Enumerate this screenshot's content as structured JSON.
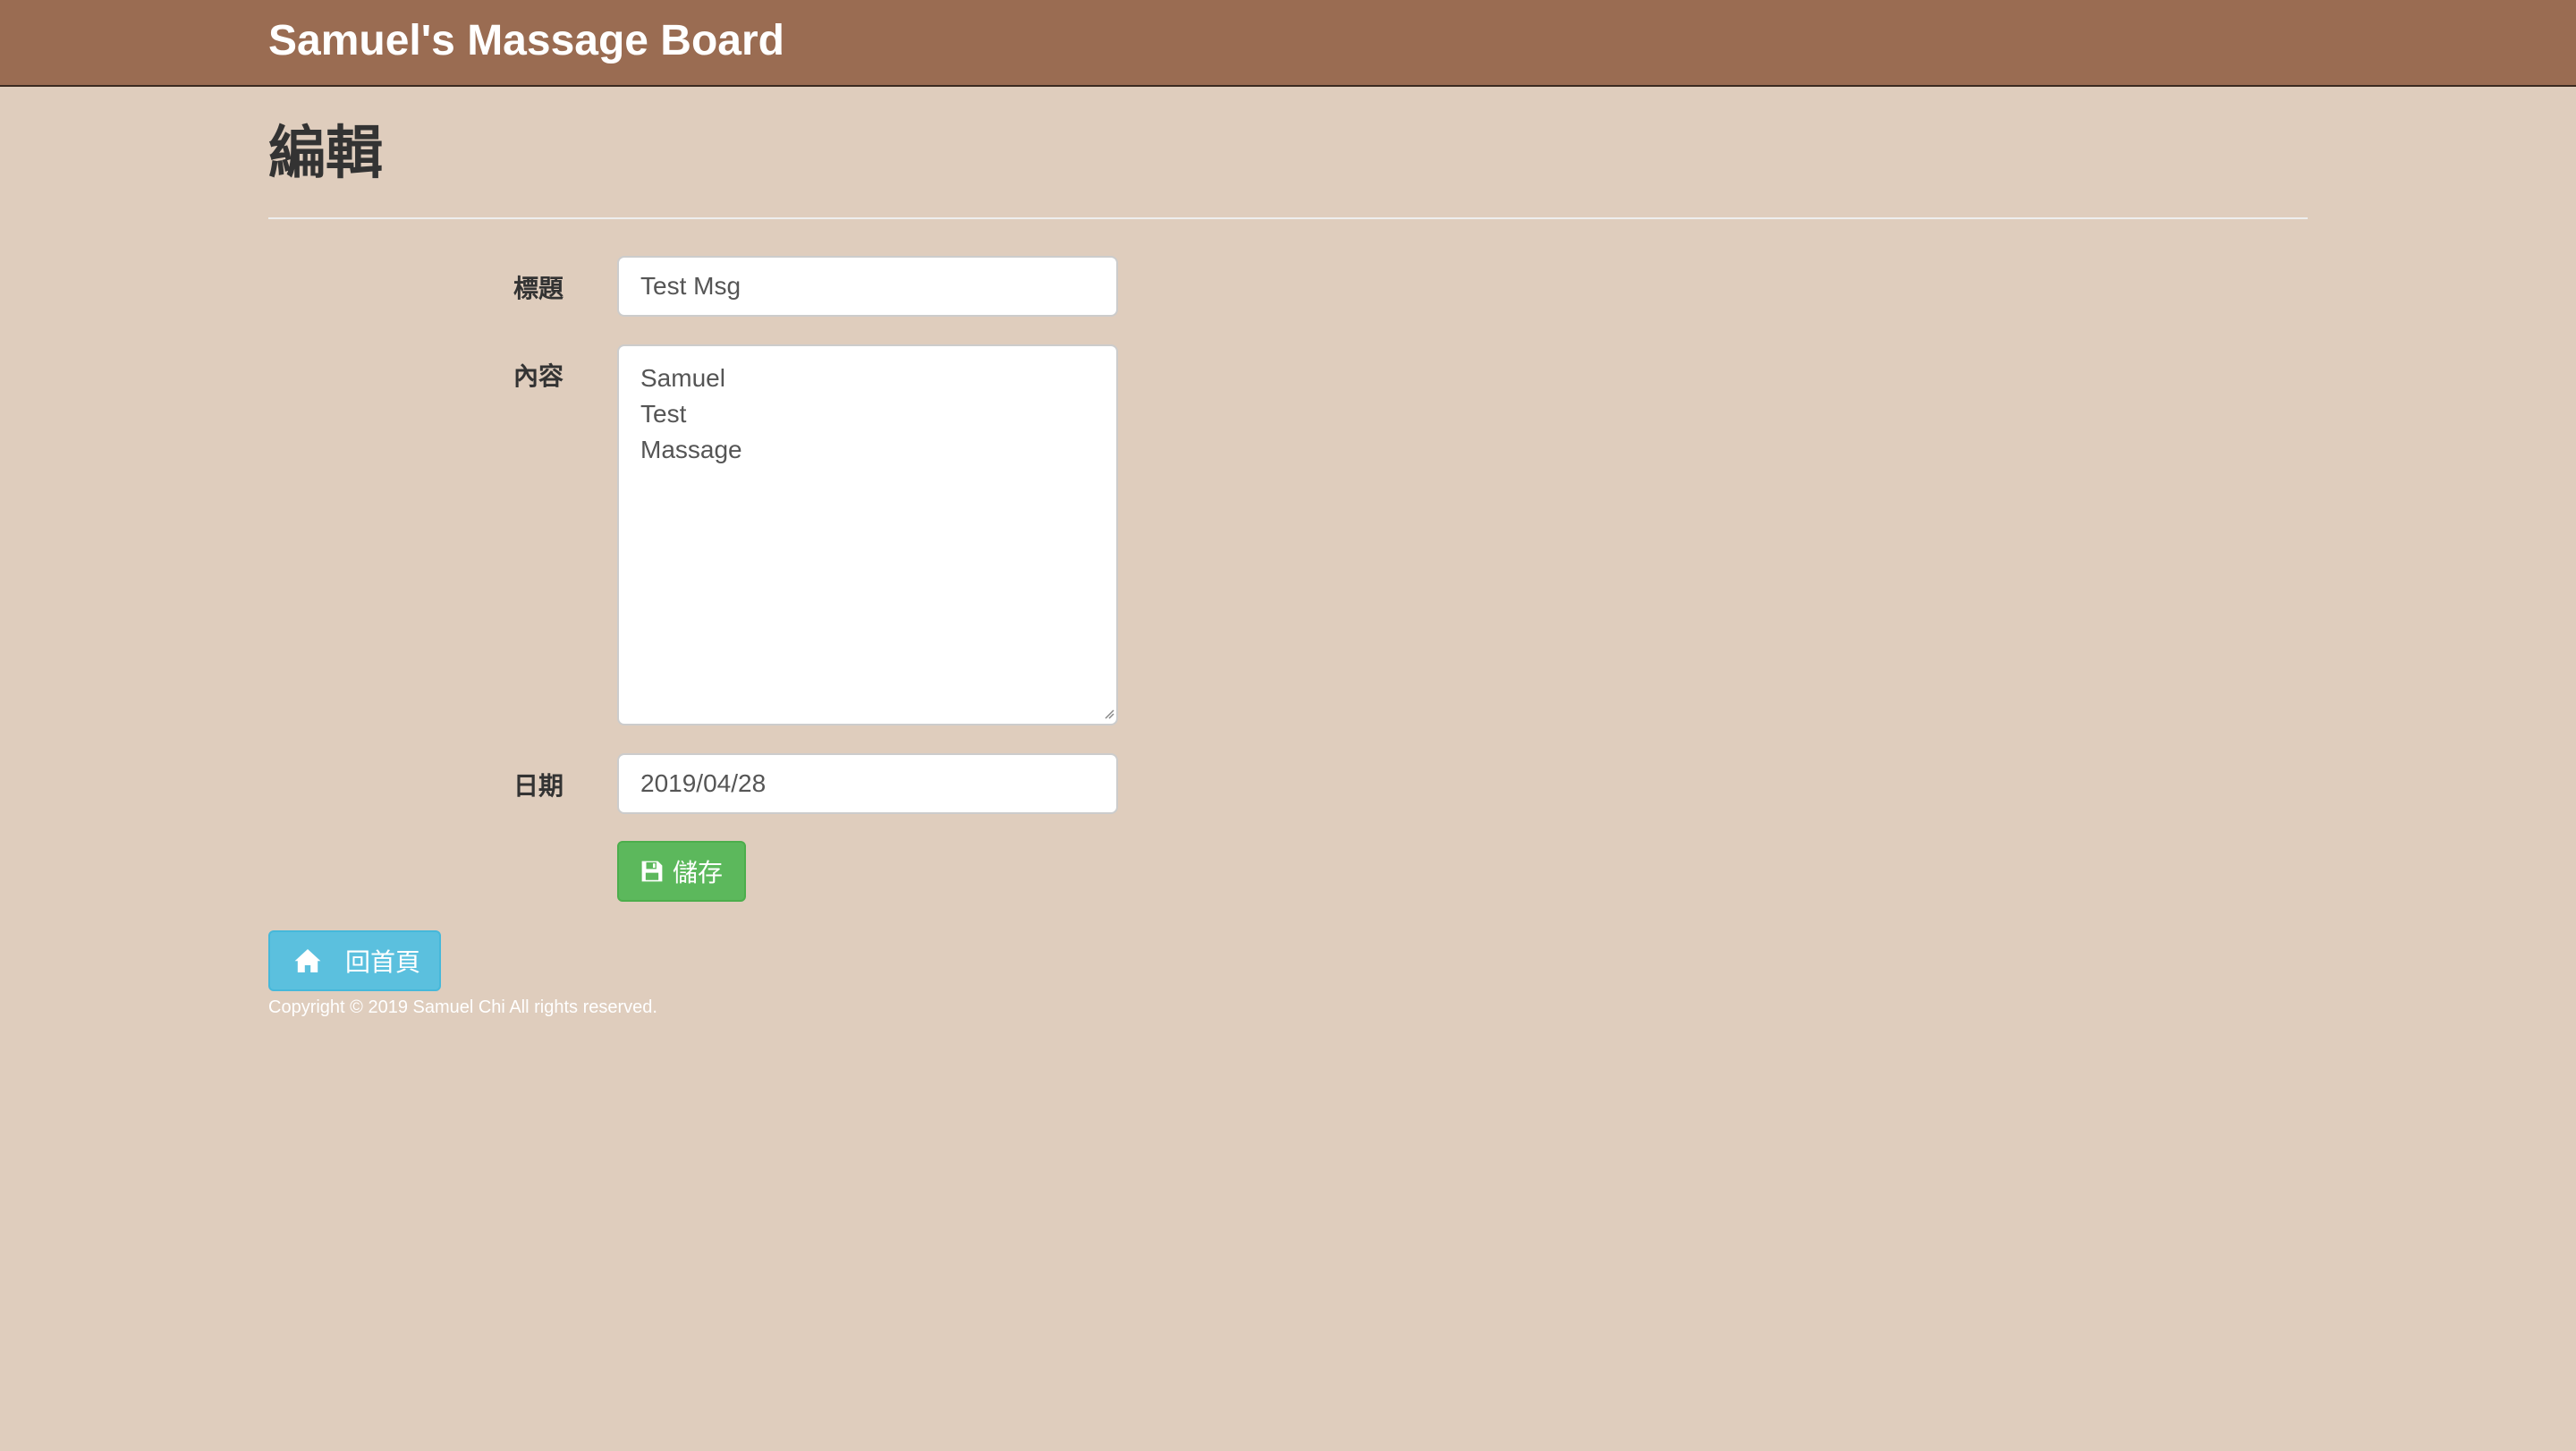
{
  "navbar": {
    "brand": "Samuel's Massage Board"
  },
  "page": {
    "title": "編輯"
  },
  "form": {
    "title_label": "標題",
    "title_value": "Test Msg",
    "content_label": "內容",
    "content_value": "Samuel\nTest\nMassage",
    "date_label": "日期",
    "date_value": "2019/04/28",
    "save_label": "儲存",
    "save_icon": "floppy-disk-icon"
  },
  "nav": {
    "home_label": "回首頁",
    "home_icon": "home-icon"
  },
  "footer": {
    "copyright": "Copyright © 2019 Samuel Chi All rights reserved."
  },
  "colors": {
    "navbar_bg": "#9a6c52",
    "page_bg": "#dfcdbd",
    "save_button": "#5cb85c",
    "home_button": "#5bc0de"
  }
}
